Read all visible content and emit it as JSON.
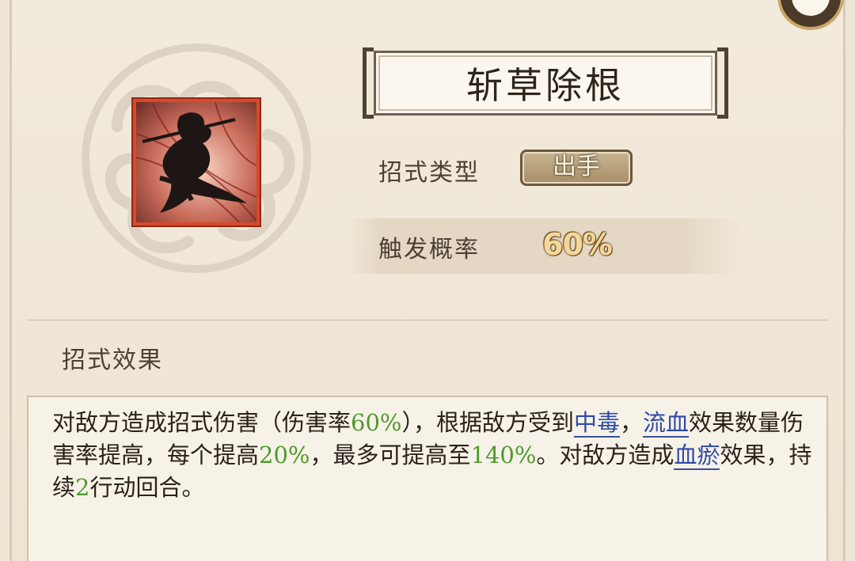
{
  "skill": {
    "name": "斩草除根",
    "type_label": "招式类型",
    "type_value": "出手",
    "trigger_label": "触发概率",
    "trigger_value": "60%",
    "icon": "ninja-slash-icon"
  },
  "effect": {
    "title": "招式效果",
    "segments": [
      {
        "text": "对敌方造成招式伤害（伤害率",
        "style": "normal"
      },
      {
        "text": "60%",
        "style": "green"
      },
      {
        "text": "），根据敌方受到",
        "style": "normal"
      },
      {
        "text": "中毒",
        "style": "blue"
      },
      {
        "text": "，",
        "style": "normal"
      },
      {
        "text": "流血",
        "style": "blue"
      },
      {
        "text": "效果数量伤害率提高，每个提高",
        "style": "normal"
      },
      {
        "text": "20%",
        "style": "green"
      },
      {
        "text": "，最多可提高至",
        "style": "normal"
      },
      {
        "text": "140%",
        "style": "green"
      },
      {
        "text": "。对敌方造成",
        "style": "normal"
      },
      {
        "text": "血瘀",
        "style": "blue"
      },
      {
        "text": "效果，持续",
        "style": "normal"
      },
      {
        "text": "2",
        "style": "green"
      },
      {
        "text": "行动回合。",
        "style": "normal"
      }
    ]
  },
  "colors": {
    "green": "#4f9a2e",
    "blue": "#2f4aa6",
    "icon_border": "#d9492a"
  }
}
